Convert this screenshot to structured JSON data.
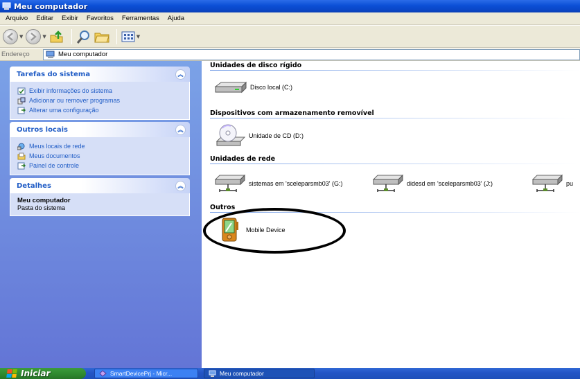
{
  "window": {
    "title": "Meu computador"
  },
  "menu": [
    "Arquivo",
    "Editar",
    "Exibir",
    "Favoritos",
    "Ferramentas",
    "Ajuda"
  ],
  "address": {
    "label": "Endereço",
    "value": "Meu computador"
  },
  "left_panels": {
    "system_tasks": {
      "title": "Tarefas do sistema",
      "links": [
        "Exibir informações do sistema",
        "Adicionar ou remover programas",
        "Alterar uma configuração"
      ]
    },
    "other_places": {
      "title": "Outros locais",
      "links": [
        "Meus locais de rede",
        "Meus documentos",
        "Painel de controle"
      ]
    },
    "details": {
      "title": "Detalhes",
      "name": "Meu computador",
      "subtitle": "Pasta do sistema"
    }
  },
  "groups": {
    "hard_disks": {
      "title": "Unidades de disco rígido",
      "items": [
        "Disco local (C:)"
      ]
    },
    "removable": {
      "title": "Dispositivos com armazenamento removível",
      "items": [
        "Unidade de CD (D:)"
      ]
    },
    "network": {
      "title": "Unidades de rede",
      "items": [
        "sistemas em 'sceleparsmb03' (G:)",
        "didesd em 'sceleparsmb03' (J:)",
        "pu"
      ]
    },
    "others": {
      "title": "Outros",
      "items": [
        "Mobile Device"
      ]
    }
  },
  "taskbar": {
    "start_label": "Iniciar",
    "buttons": [
      "SmartDevicePrj - Micr...",
      "Meu computador"
    ]
  },
  "colors": {
    "titlebar": "#0b4fd6",
    "taskpane": "#6375d6",
    "link": "#215dc6",
    "start": "#2f8a2f"
  }
}
